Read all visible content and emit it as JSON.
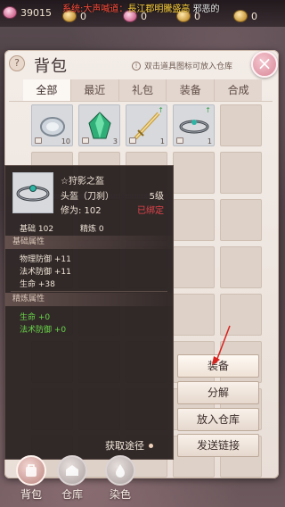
{
  "currency": {
    "gold": "39015",
    "items": [
      {
        "value": "0",
        "icon": "gold-ingot-icon"
      },
      {
        "value": "0",
        "icon": "pink-gem-icon"
      },
      {
        "value": "0",
        "icon": "gold-ingot-icon"
      },
      {
        "value": "0",
        "icon": "gold-ingot-icon"
      }
    ]
  },
  "marquee": {
    "part1": "系统:大声喊道：",
    "part2": "長江郡明騰盛高",
    "part3": "邪恶的"
  },
  "bag": {
    "title": "背包",
    "help": "?",
    "hint": "双击道具图标可放入仓库",
    "close": "×",
    "tabs": [
      "全部",
      "最近",
      "礼包",
      "装备",
      "合成"
    ],
    "active_tab": "全部",
    "slots": [
      {
        "icon": "silver-ring-icon",
        "qty": "10",
        "locked": true,
        "upgrade": false
      },
      {
        "icon": "green-crystal-icon",
        "qty": "3",
        "locked": true,
        "upgrade": false
      },
      {
        "icon": "golden-sword-icon",
        "qty": "1",
        "locked": true,
        "upgrade": true
      },
      {
        "icon": "jade-headband-icon",
        "qty": "1",
        "locked": true,
        "upgrade": true
      }
    ]
  },
  "tooltip": {
    "name": "☆狩影之盔",
    "slot": "头盔（刀刹）",
    "level": "5级",
    "repair": "修为: 102",
    "bound": "已绑定",
    "base": "基础 102",
    "refine": "精炼 0",
    "base_section": "基础属性",
    "base_attrs": [
      "物理防御 +11",
      "法术防御 +11",
      "生命 +38"
    ],
    "refine_section": "精炼属性",
    "refine_attrs": [
      "生命 +0",
      "法术防御 +0"
    ],
    "source": "获取途径"
  },
  "actions": [
    "装备",
    "分解",
    "放入仓库",
    "发送链接"
  ],
  "nav": [
    {
      "label": "背包",
      "icon": "backpack-icon",
      "active": true
    },
    {
      "label": "仓库",
      "icon": "warehouse-icon",
      "active": false
    },
    {
      "label": "染色",
      "icon": "dye-icon",
      "active": false
    }
  ],
  "colors": {
    "bound": "#e2434a",
    "refine_attr": "#68d648",
    "marquee": "#ff4d3b"
  }
}
